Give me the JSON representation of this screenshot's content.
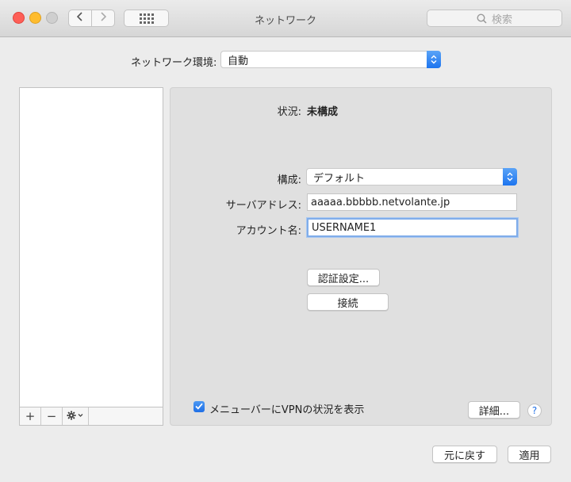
{
  "window": {
    "title": "ネットワーク"
  },
  "toolbar": {
    "search_placeholder": "検索"
  },
  "location": {
    "label": "ネットワーク環境:",
    "value": "自動"
  },
  "sidebar": {
    "add_label": "+",
    "remove_label": "−",
    "items": []
  },
  "detail": {
    "status_label": "状況:",
    "status_value": "未構成",
    "configuration_label": "構成:",
    "configuration_value": "デフォルト",
    "server_label": "サーバアドレス:",
    "server_value": "aaaaa.bbbbb.netvolante.jp",
    "account_label": "アカウント名:",
    "account_value": "USERNAME1",
    "auth_button": "認証設定...",
    "connect_button": "接続",
    "show_vpn_status_label": "メニューバーにVPNの状況を表示",
    "show_vpn_status_checked": true,
    "advanced_button": "詳細...",
    "help_label": "?"
  },
  "footer": {
    "revert_button": "元に戻す",
    "apply_button": "適用"
  },
  "colors": {
    "accent": "#1f6fe6",
    "close": "#fe5f57",
    "minimize": "#febc2e"
  }
}
